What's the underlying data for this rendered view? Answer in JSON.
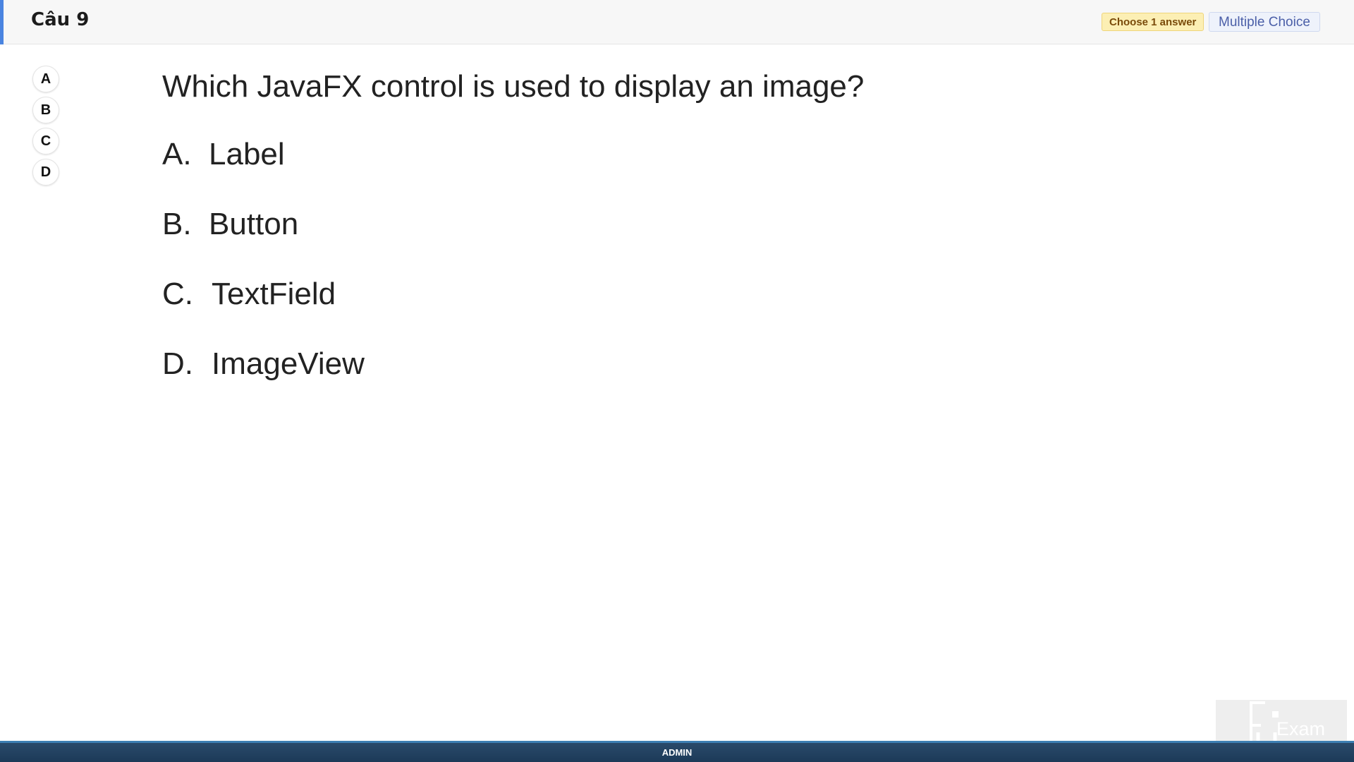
{
  "header": {
    "title": "Câu 9",
    "badge_choose": "Choose 1 answer",
    "badge_type": "Multiple Choice",
    "accent_color": "#4a84e0"
  },
  "option_buttons": [
    "A",
    "B",
    "C",
    "D"
  ],
  "question": {
    "text": "Which JavaFX control is used to display an image?",
    "answers": [
      {
        "letter": "A.",
        "text": "Label"
      },
      {
        "letter": "B.",
        "text": "Button"
      },
      {
        "letter": "C.",
        "text": "TextField"
      },
      {
        "letter": "D.",
        "text": "ImageView"
      }
    ]
  },
  "logo": {
    "text": "Exam",
    "icon": "fu-exam-logo-icon"
  },
  "footer": {
    "user": "ADMIN"
  }
}
